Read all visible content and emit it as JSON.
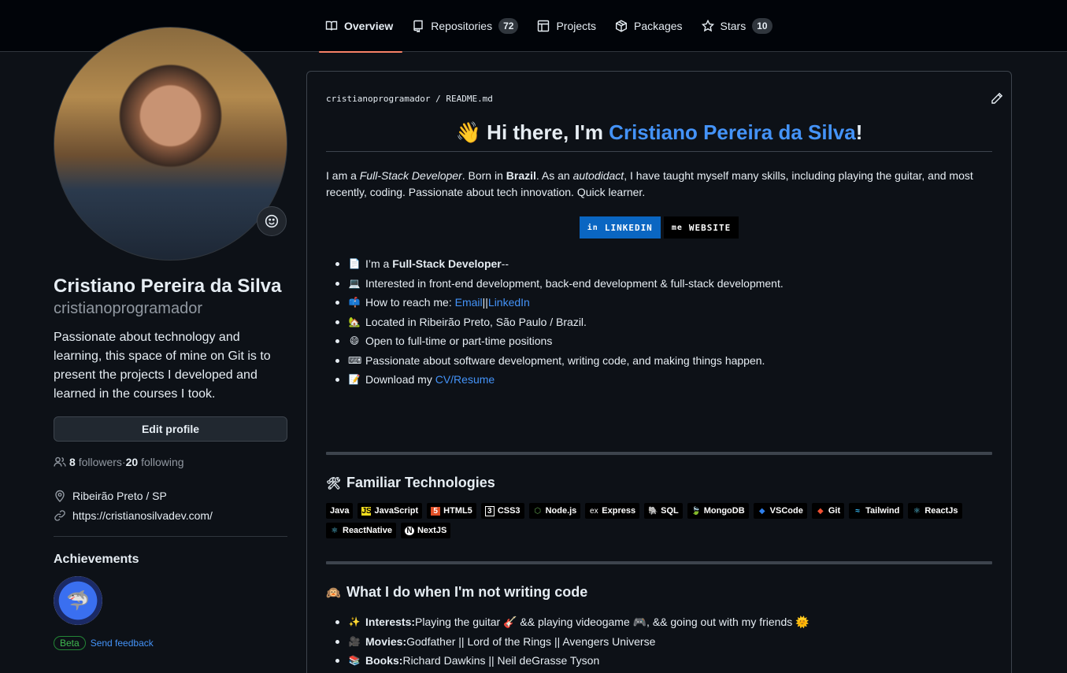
{
  "nav": {
    "tabs": [
      {
        "label": "Overview",
        "count": null
      },
      {
        "label": "Repositories",
        "count": "72"
      },
      {
        "label": "Projects",
        "count": null
      },
      {
        "label": "Packages",
        "count": null
      },
      {
        "label": "Stars",
        "count": "10"
      }
    ]
  },
  "profile": {
    "name": "Cristiano Pereira da Silva",
    "login": "cristianoprogramador",
    "bio": "Passionate about technology and learning, this space of mine on Git is to present the projects I developed and learned in the courses I took.",
    "edit_label": "Edit profile",
    "followers_count": "8",
    "followers_label": "followers",
    "separator": " · ",
    "following_count": "20",
    "following_label": "following",
    "location": "Ribeirão Preto / SP",
    "website": "https://cristianosilvadev.com/",
    "achievements_title": "Achievements",
    "beta_label": "Beta",
    "feedback_label": "Send feedback"
  },
  "readme": {
    "path_user": "cristianoprogramador",
    "path_sep": " / ",
    "path_file": "README.md",
    "title_emoji": "👋",
    "title_prefix": "Hi there, I'm ",
    "title_name": "Cristiano Pereira da Silva",
    "title_suffix": "!",
    "intro": {
      "p1": "I am a ",
      "em1": "Full-Stack Developer",
      "p2": ". Born in ",
      "b1": "Brazil",
      "p3": ". As an ",
      "em2": "autodidact",
      "p4": ", I have taught myself many skills, including playing the guitar, and most recently, coding. Passionate about tech innovation. Quick learner."
    },
    "buttons": [
      {
        "icon": "in",
        "label": "LINKEDIN"
      },
      {
        "icon": "me",
        "label": "WEBSITE"
      }
    ],
    "about": {
      "i1": {
        "emoji": "📄",
        "pre": "I’m a ",
        "bold": "Full-Stack Developer",
        "post": " --"
      },
      "i2": {
        "emoji": "💻",
        "text": "Interested in front-end development, back-end development & full-stack development."
      },
      "i3": {
        "emoji": "📫",
        "pre": "How to reach me: ",
        "link1": "Email",
        "mid": " || ",
        "link2": "LinkedIn"
      },
      "i4": {
        "emoji": "🏡",
        "text": "Located in Ribeirão Preto, São Paulo / Brazil."
      },
      "i5": {
        "emoji": "😄",
        "text": "Open to full-time or part-time positions"
      },
      "i6": {
        "emoji": "⌨",
        "text": "Passionate about software development, writing code, and making things happen."
      },
      "i7": {
        "emoji": "📝",
        "pre": "Download my ",
        "link": "CV/Resume"
      }
    },
    "tech_title": "Familiar Technologies",
    "tech_emoji": "🛠",
    "tech": [
      {
        "icon": "",
        "label": "Java"
      },
      {
        "icon": "JS",
        "label": "JavaScript"
      },
      {
        "icon": "5",
        "label": "HTML5"
      },
      {
        "icon": "3",
        "label": "CSS3"
      },
      {
        "icon": "⬡",
        "label": "Node.js"
      },
      {
        "icon": "ex",
        "label": "Express"
      },
      {
        "icon": "🐘",
        "label": "SQL"
      },
      {
        "icon": "🍃",
        "label": "MongoDB"
      },
      {
        "icon": "◆",
        "label": "VSCode"
      },
      {
        "icon": "◆",
        "label": "Git"
      },
      {
        "icon": "≈",
        "label": "Tailwind"
      },
      {
        "icon": "⚛",
        "label": "ReactJs"
      },
      {
        "icon": "⚛",
        "label": "ReactNative"
      },
      {
        "icon": "N",
        "label": "NextJS"
      }
    ],
    "hobby_title": "What I do when I'm not writing code",
    "hobby_emoji": "🙉",
    "hobbies": {
      "h1": {
        "emoji": "✨",
        "bold": "Interests:",
        "text": " Playing the guitar 🎸 && playing videogame 🎮, && going out with my friends 🌞"
      },
      "h2": {
        "emoji": "🎥",
        "bold": "Movies:",
        "text": " Godfather || Lord of the Rings || Avengers Universe"
      },
      "h3": {
        "emoji": "📚",
        "bold": "Books:",
        "text": " Richard Dawkins || Neil deGrasse Tyson"
      }
    }
  },
  "colors": {
    "background": "#0d1117",
    "accent_tab": "#f78166",
    "link": "#4493f8",
    "linkedin": "#0a66c2"
  }
}
